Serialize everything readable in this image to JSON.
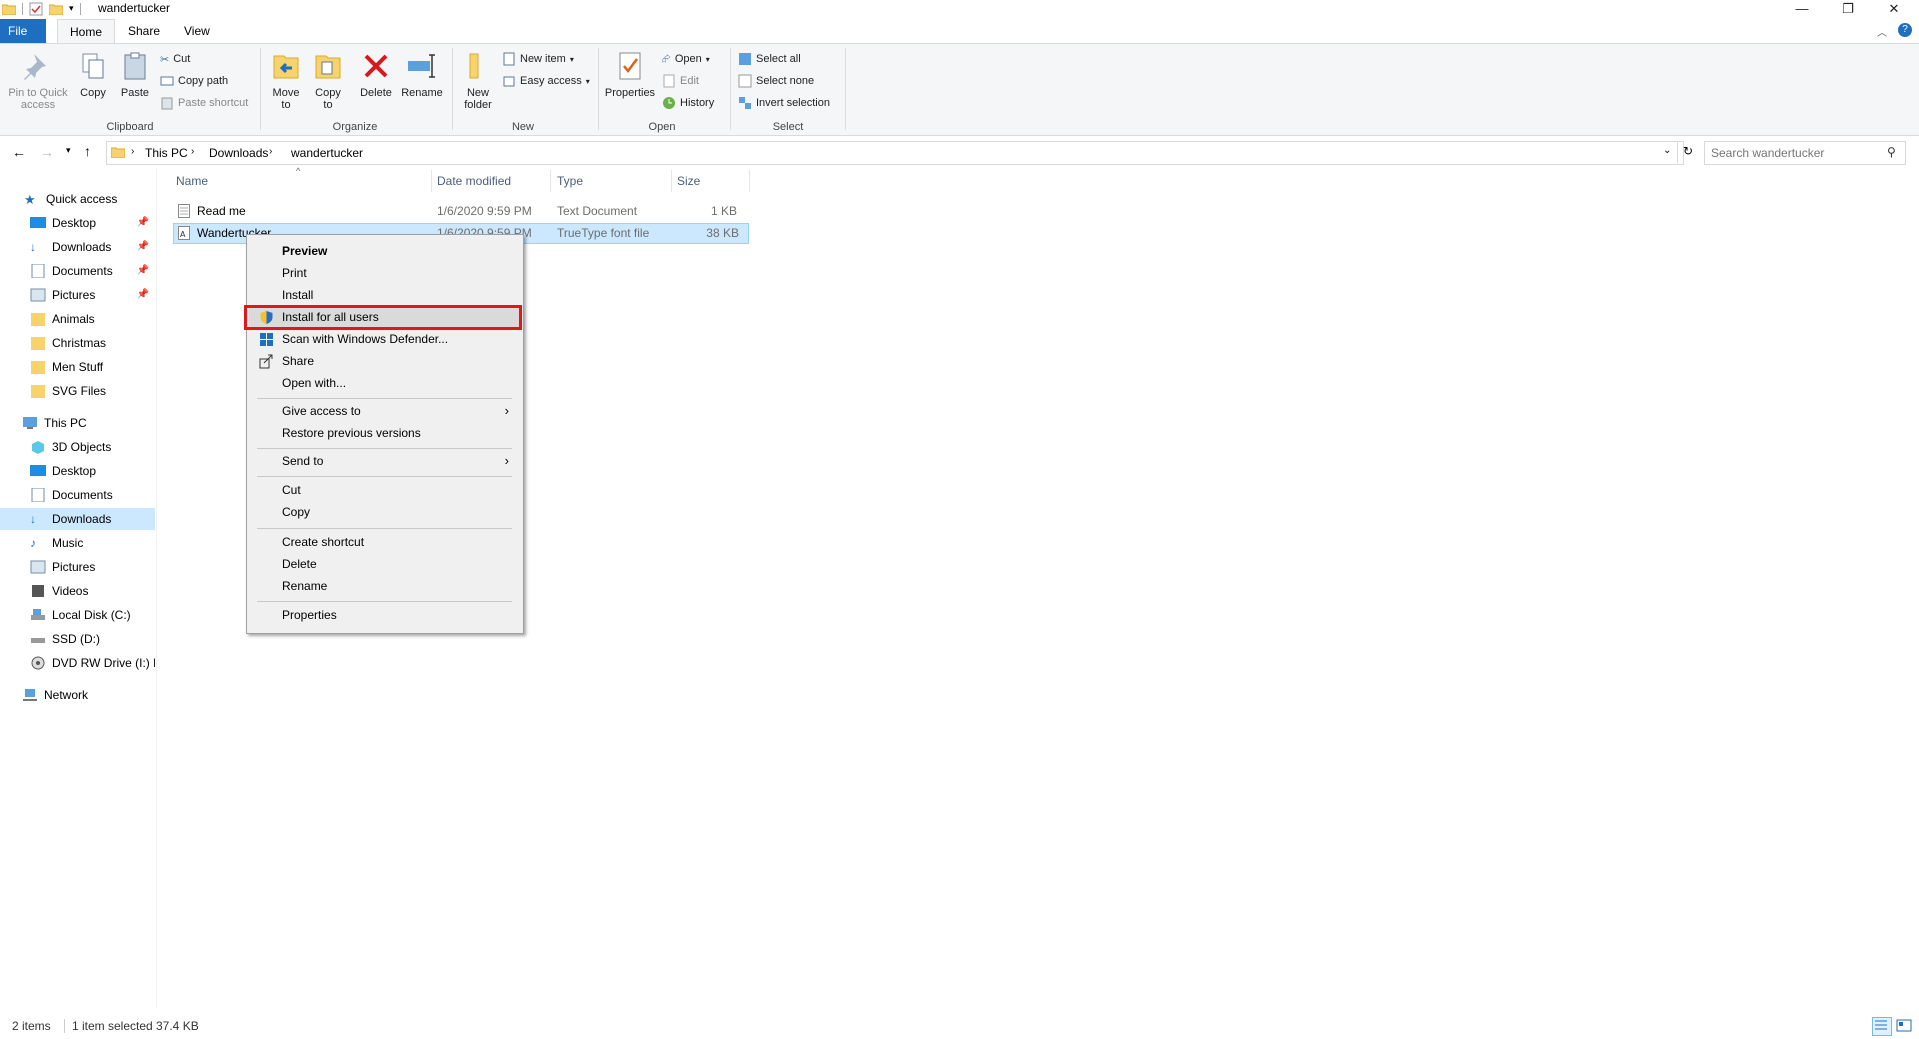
{
  "window": {
    "title": "wandertucker"
  },
  "tabs": {
    "file": "File",
    "home": "Home",
    "share": "Share",
    "view": "View"
  },
  "ribbon": {
    "clipboard": {
      "pin": "Pin to Quick access",
      "copy": "Copy",
      "paste": "Paste",
      "cut": "Cut",
      "copy_path": "Copy path",
      "paste_shortcut": "Paste shortcut",
      "label": "Clipboard"
    },
    "organize": {
      "move_to": "Move to",
      "copy_to": "Copy to",
      "delete": "Delete",
      "rename": "Rename",
      "label": "Organize"
    },
    "new": {
      "new_folder": "New folder",
      "new_item": "New item",
      "easy_access": "Easy access",
      "label": "New"
    },
    "open": {
      "properties": "Properties",
      "open": "Open",
      "edit": "Edit",
      "history": "History",
      "label": "Open"
    },
    "select": {
      "select_all": "Select all",
      "select_none": "Select none",
      "invert": "Invert selection",
      "label": "Select"
    }
  },
  "address": {
    "crumbs": [
      "This PC",
      "Downloads",
      "wandertucker"
    ],
    "search_placeholder": "Search wandertucker"
  },
  "nav": {
    "quick_access": "Quick access",
    "quick_items": [
      "Desktop",
      "Downloads",
      "Documents",
      "Pictures",
      "Animals",
      "Christmas",
      "Men Stuff",
      "SVG Files"
    ],
    "this_pc": "This PC",
    "pc_items": [
      "3D Objects",
      "Desktop",
      "Documents",
      "Downloads",
      "Music",
      "Pictures",
      "Videos",
      "Local Disk (C:)",
      "SSD (D:)",
      "DVD RW Drive (I:) R"
    ],
    "network": "Network"
  },
  "columns": {
    "name": "Name",
    "date": "Date modified",
    "type": "Type",
    "size": "Size"
  },
  "files": [
    {
      "name": "Read me",
      "date": "1/6/2020 9:59 PM",
      "type": "Text Document",
      "size": "1 KB"
    },
    {
      "name": "Wandertucker",
      "date": "1/6/2020 9:59 PM",
      "type": "TrueType font file",
      "size": "38 KB"
    }
  ],
  "context_menu": {
    "preview": "Preview",
    "print": "Print",
    "install": "Install",
    "install_all": "Install for all users",
    "scan": "Scan with Windows Defender...",
    "share": "Share",
    "open_with": "Open with...",
    "give_access": "Give access to",
    "restore": "Restore previous versions",
    "send_to": "Send to",
    "cut": "Cut",
    "copy": "Copy",
    "create_shortcut": "Create shortcut",
    "delete": "Delete",
    "rename": "Rename",
    "properties": "Properties"
  },
  "status": {
    "items": "2 items",
    "selected": "1 item selected",
    "size": "37.4 KB"
  },
  "colors": {
    "accent": "#1e6fc0",
    "selection": "#cce8ff",
    "highlight": "#e3161d"
  }
}
